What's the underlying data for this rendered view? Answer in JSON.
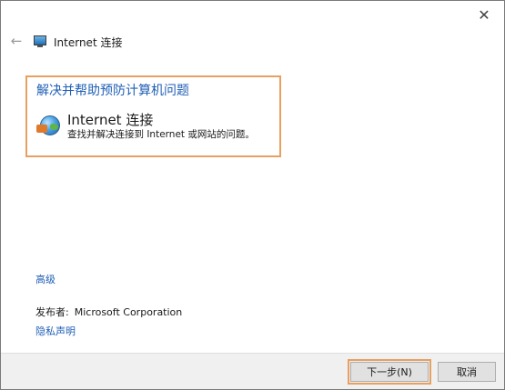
{
  "window": {
    "title": "Internet 连接",
    "close_glyph": "✕",
    "back_glyph": "←",
    "title_icon": "network-icon"
  },
  "task": {
    "heading": "解决并帮助预防计算机问题",
    "item_title": "Internet 连接",
    "item_description": "查找并解决连接到 Internet 或网站的问题。",
    "item_icon": "internet-connection-icon"
  },
  "links": {
    "advanced": "高级",
    "privacy": "隐私声明"
  },
  "publisher": {
    "label": "发布者:",
    "value": "Microsoft Corporation"
  },
  "buttons": {
    "next": "下一步(N)",
    "cancel": "取消"
  },
  "colors": {
    "link": "#1f5fb5",
    "highlight_border": "#e8a060",
    "footer_bg": "#f0f0f0"
  }
}
